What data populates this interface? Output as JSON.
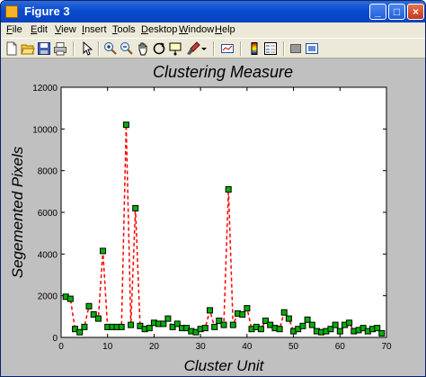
{
  "window": {
    "title": "Figure 3",
    "controls": {
      "minimize": "_",
      "maximize": "□",
      "close": "×"
    }
  },
  "menu": {
    "items": [
      {
        "u": "F",
        "rest": "ile"
      },
      {
        "u": "E",
        "rest": "dit"
      },
      {
        "u": "V",
        "rest": "iew"
      },
      {
        "u": "I",
        "rest": "nsert"
      },
      {
        "u": "T",
        "rest": "ools"
      },
      {
        "u": "D",
        "rest": "esktop"
      },
      {
        "u": "W",
        "rest": "indow"
      },
      {
        "u": "H",
        "rest": "elp"
      }
    ]
  },
  "toolbar": {
    "icons": [
      "new-figure-icon",
      "open-file-icon",
      "save-icon",
      "print-icon",
      "edit-plot-arrow-icon",
      "zoom-in-icon",
      "zoom-out-icon",
      "pan-hand-icon",
      "rotate-3d-icon",
      "data-cursor-icon",
      "brush-icon",
      "brush-dropdown-icon",
      "link-plot-icon",
      "insert-colorbar-icon",
      "insert-legend-icon",
      "hide-plot-tools-icon",
      "show-plot-tools-icon"
    ]
  },
  "chart_data": {
    "type": "line",
    "title": "Clustering Measure",
    "xlabel": "Cluster Unit",
    "ylabel": "Segemented Pixels",
    "xlim": [
      0,
      70
    ],
    "ylim": [
      0,
      12000
    ],
    "xticks": [
      "0",
      "10",
      "20",
      "30",
      "40",
      "50",
      "60",
      "70"
    ],
    "yticks": [
      "0",
      "2000",
      "4000",
      "6000",
      "8000",
      "10000",
      "12000"
    ],
    "grid": false,
    "line_color": "#ff0000",
    "line_style": "dashed",
    "marker": "square",
    "marker_face": "#00b000",
    "marker_edge": "#000000",
    "x": [
      1,
      2,
      3,
      4,
      5,
      6,
      7,
      8,
      9,
      10,
      11,
      12,
      13,
      14,
      15,
      16,
      17,
      18,
      19,
      20,
      21,
      22,
      23,
      24,
      25,
      26,
      27,
      28,
      29,
      30,
      31,
      32,
      33,
      34,
      35,
      36,
      37,
      38,
      39,
      40,
      41,
      42,
      43,
      44,
      45,
      46,
      47,
      48,
      49,
      50,
      51,
      52,
      53,
      54,
      55,
      56,
      57,
      58,
      59,
      60,
      61,
      62,
      63,
      64,
      65,
      66,
      67,
      68,
      69
    ],
    "y": [
      1950,
      1850,
      400,
      250,
      500,
      1500,
      1100,
      900,
      4150,
      500,
      500,
      500,
      500,
      10200,
      600,
      6200,
      550,
      400,
      450,
      700,
      650,
      650,
      900,
      500,
      650,
      450,
      450,
      300,
      250,
      400,
      450,
      1300,
      500,
      800,
      600,
      7100,
      600,
      1150,
      1100,
      1400,
      400,
      500,
      400,
      800,
      600,
      450,
      400,
      1200,
      900,
      300,
      400,
      550,
      850,
      600,
      300,
      250,
      300,
      400,
      600,
      300,
      600,
      700,
      300,
      350,
      450,
      300,
      400,
      450,
      200
    ]
  }
}
